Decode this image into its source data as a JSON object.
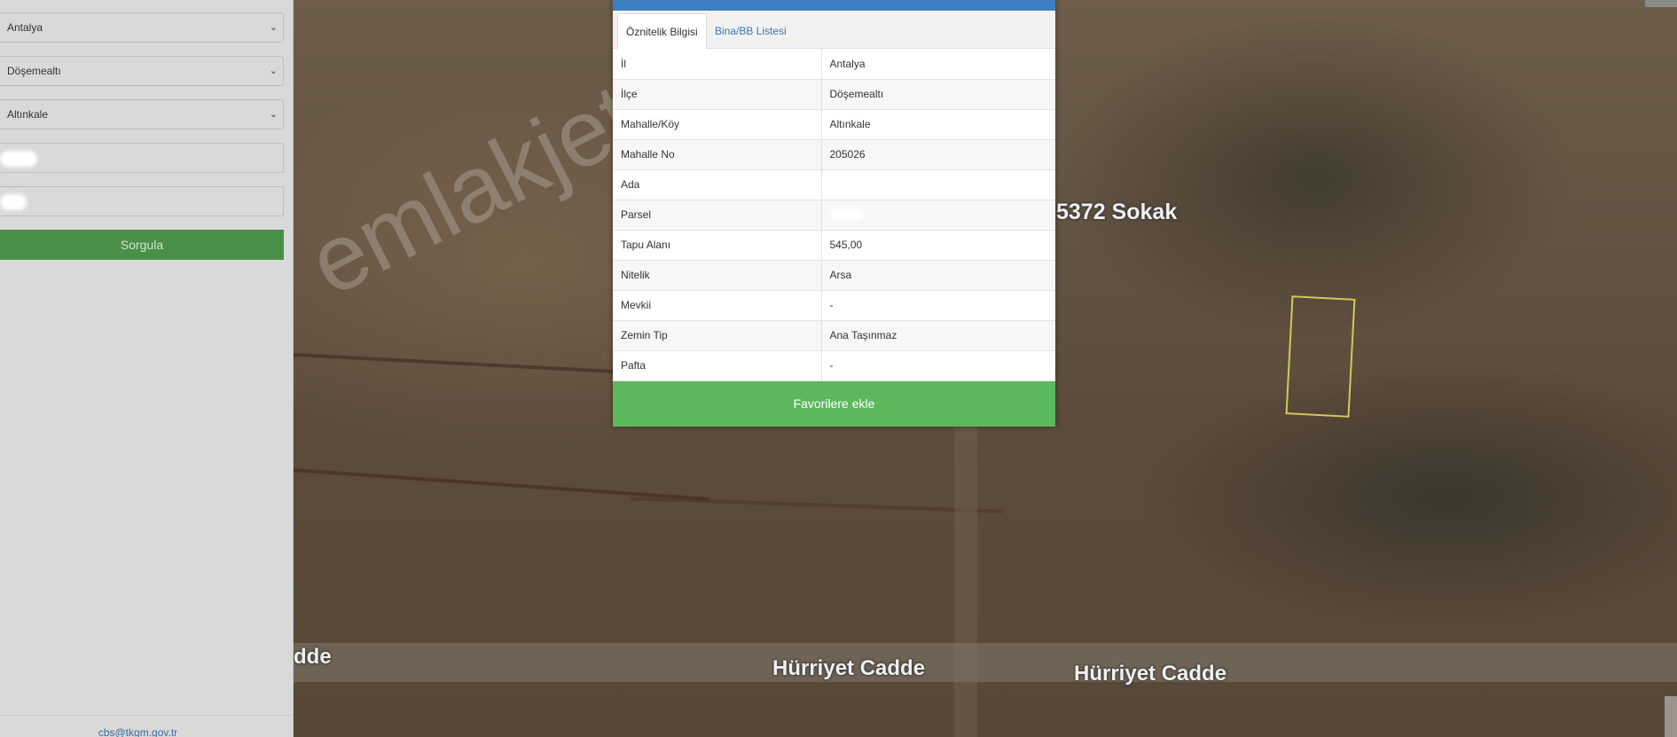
{
  "sidebar": {
    "il_select": "Antalya",
    "ilce_select": "Döşemealtı",
    "mahalle_select": "Altınkale",
    "ada_input": "",
    "parsel_input": "",
    "query_button": "Sorgula",
    "footer_email": "cbs@tkgm.gov.tr"
  },
  "map": {
    "labels": {
      "street_top": "5372 Sokak",
      "road_left": "dde",
      "road_mid": "Hürriyet Cadde",
      "road_right": "Hürriyet Cadde"
    },
    "watermark": "emlakjet.com"
  },
  "popup": {
    "tabs": [
      "Öznitelik Bilgisi",
      "Bina/BB Listesi"
    ],
    "rows": [
      {
        "key": "İl",
        "value": "Antalya"
      },
      {
        "key": "İlçe",
        "value": "Döşemealtı"
      },
      {
        "key": "Mahalle/Köy",
        "value": "Altınkale"
      },
      {
        "key": "Mahalle No",
        "value": "205026"
      },
      {
        "key": "Ada",
        "value": ""
      },
      {
        "key": "Parsel",
        "value": ""
      },
      {
        "key": "Tapu Alanı",
        "value": "545,00"
      },
      {
        "key": "Nitelik",
        "value": "Arsa"
      },
      {
        "key": "Mevkii",
        "value": "-"
      },
      {
        "key": "Zemin Tip",
        "value": "Ana Taşınmaz"
      },
      {
        "key": "Pafta",
        "value": "-"
      }
    ],
    "favorite_button": "Favorilere ekle"
  },
  "colors": {
    "header_blue": "#3d7fc0",
    "favorite_green": "#5cb85c",
    "query_green": "#4a8f47",
    "parcel_outline": "#d6c85a"
  }
}
